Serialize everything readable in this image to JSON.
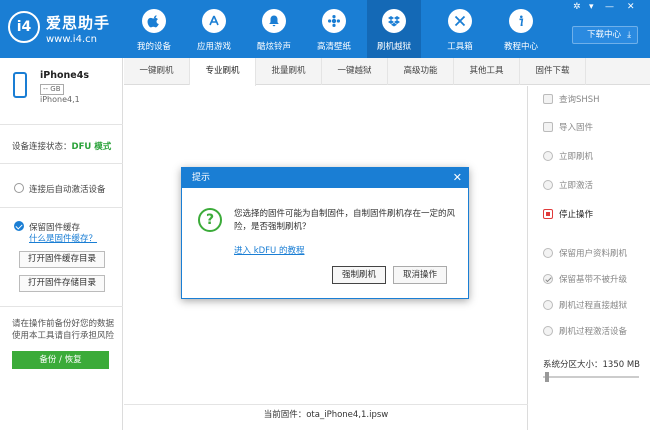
{
  "header": {
    "logo_circle": "i4",
    "logo_name": "爱思助手",
    "logo_url": "www.i4.cn",
    "nav": [
      {
        "label": "我的设备",
        "icon": "apple-icon"
      },
      {
        "label": "应用游戏",
        "icon": "app-store-icon"
      },
      {
        "label": "酷炫铃声",
        "icon": "bell-icon"
      },
      {
        "label": "高清壁纸",
        "icon": "gear-flower-icon"
      },
      {
        "label": "刷机越狱",
        "icon": "dropbox-icon"
      },
      {
        "label": "工具箱",
        "icon": "tools-icon"
      },
      {
        "label": "教程中心",
        "icon": "info-icon"
      }
    ],
    "active_nav": "刷机越狱",
    "window_controls": [
      "✲",
      "▾",
      "—",
      "✕"
    ],
    "download_center": "下载中心"
  },
  "device": {
    "name": "iPhone4s",
    "capacity": "-- GB",
    "model": "iPhone4,1",
    "status_label": "设备连接状态：",
    "status_value": "DFU 模式"
  },
  "left": {
    "auto_activate": "连接后自动激活设备",
    "keep_cache": "保留固件缓存",
    "what_cache": "什么是固件缓存？",
    "open_cache_dir": "打开固件缓存目录",
    "open_store_dir": "打开固件存储目录",
    "warning": "请在操作前备份好您的数据使用本工具请自行承担风险",
    "backup_btn": "备份 / 恢复"
  },
  "tabs": [
    "一键刷机",
    "专业刷机",
    "批量刷机",
    "一键越狱",
    "高级功能",
    "其他工具",
    "固件下载"
  ],
  "active_tab": "专业刷机",
  "main": {
    "current_firmware": "当前固件：ota_iPhone4,1.ipsw"
  },
  "right": {
    "items": [
      {
        "label": "查询SHSH",
        "state": "disabled"
      },
      {
        "label": "导入固件",
        "state": "disabled"
      },
      {
        "label": "立即刷机",
        "state": "disabled"
      },
      {
        "label": "立即激活",
        "state": "disabled"
      },
      {
        "label": "停止操作",
        "state": "active"
      }
    ],
    "options": [
      {
        "label": "保留用户资料刷机",
        "checked": false
      },
      {
        "label": "保留基带不被升级",
        "checked": true
      },
      {
        "label": "刷机过程直接越狱",
        "checked": false
      },
      {
        "label": "刷机过程激活设备",
        "checked": false
      }
    ],
    "partition_label": "系统分区大小：1350 MB"
  },
  "modal": {
    "title": "提示",
    "close": "✕",
    "icon": "?",
    "message": "您选择的固件可能为自制固件，自制固件刷机存在一定的风险，是否强制刷机？",
    "link": "进入 kDFU 的教程",
    "confirm": "强制刷机",
    "cancel": "取消操作"
  },
  "colors": {
    "header_blue": "#1a7ed4",
    "header_active": "#1469b6",
    "status_green": "#2aa23a",
    "stop_red": "#e03a3a"
  }
}
